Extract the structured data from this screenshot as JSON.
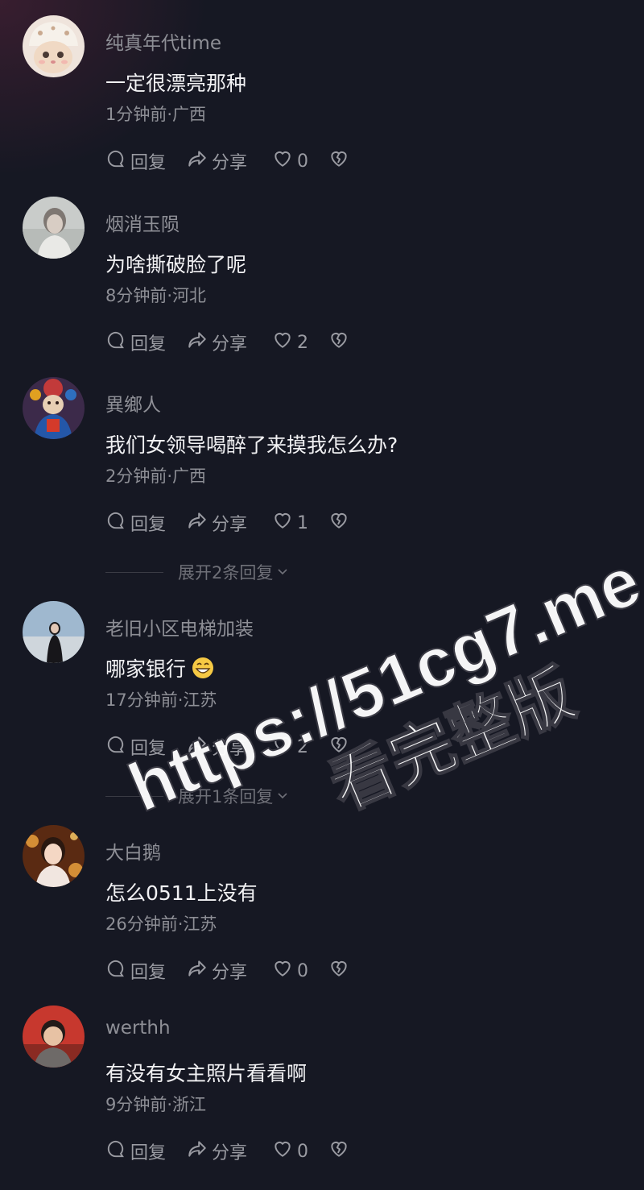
{
  "comments": [
    {
      "username": "纯真年代time",
      "text": "一定很漂亮那种",
      "meta": "1分钟前·广西",
      "likes": "0",
      "avatar": "avatar-cat-hat"
    },
    {
      "username": "烟消玉陨",
      "text": "为啥撕破脸了呢",
      "meta": "8分钟前·河北",
      "likes": "2",
      "avatar": "avatar-woman-gray"
    },
    {
      "username": "異鄉人",
      "text": "我们女领导喝醉了来摸我怎么办?",
      "meta": "2分钟前·广西",
      "likes": "1",
      "avatar": "avatar-colorful-figure"
    },
    {
      "username": "老旧小区电梯加装",
      "text": "哪家银行",
      "meta": "17分钟前·江苏",
      "likes": "2",
      "avatar": "avatar-beach-girl",
      "emoji": "grin-emoji"
    },
    {
      "username": "大白鹅",
      "text": "怎么0511上没有",
      "meta": "26分钟前·江苏",
      "likes": "0",
      "avatar": "avatar-girl-lights"
    },
    {
      "username": "werthh",
      "text": "有没有女主照片看看啊",
      "meta": "9分钟前·浙江",
      "likes": "0",
      "avatar": "avatar-boy-red"
    }
  ],
  "actions": {
    "reply": "回复",
    "share": "分享"
  },
  "expand_replies": [
    "展开2条回复",
    "展开1条回复"
  ],
  "watermark": {
    "line1": "https://51cg7.me",
    "line2": "看完整版"
  },
  "colors": {
    "background": "#161823",
    "username": "#8e8f96",
    "text": "#f1f1f3",
    "icon": "#9a9ba2"
  }
}
